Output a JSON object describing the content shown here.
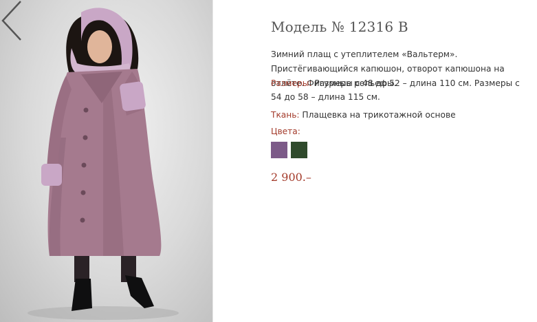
{
  "product": {
    "title": "Модель № 12316 В",
    "description": "Зимний плащ с утеплителем «Вальтерм». Пристёгивающийся капюшон, отворот капюшона на отлёте. Фигурные рельефы.",
    "sizes_label": "Размеры:",
    "sizes_value": "Размеры с 48 до 52 – длина 110 см. Размеры с 54 до 58 – длина 115 см.",
    "fabric_label": "Ткань:",
    "fabric_value": "Плащевка на трикотажной основе",
    "colors_label": "Цвета:",
    "colors": [
      {
        "hex": "#7c5a88"
      },
      {
        "hex": "#2f4a2c"
      }
    ],
    "price": "2 900.–"
  },
  "gallery": {
    "prev_icon": "chevron-left-icon"
  },
  "theme": {
    "accent": "#a33a2a",
    "title_color": "#555555",
    "text_color": "#333333"
  }
}
